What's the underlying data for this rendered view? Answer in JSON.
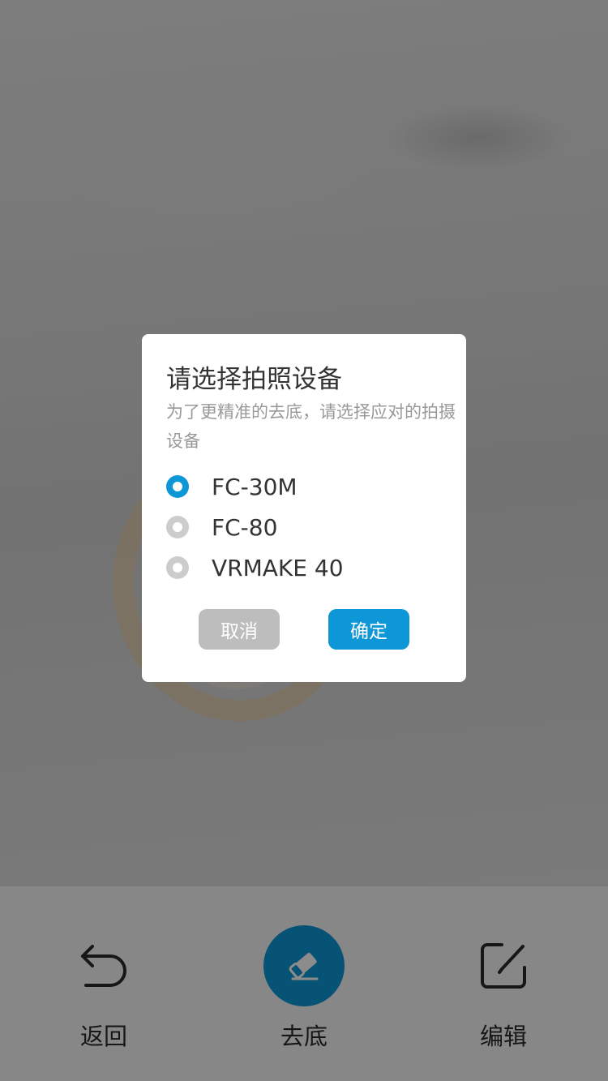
{
  "dialog": {
    "title": "请选择拍照设备",
    "description": "为了更精准的去底，请选择应对的拍摄设备",
    "options": [
      {
        "label": "FC-30M",
        "selected": true
      },
      {
        "label": "FC-80",
        "selected": false
      },
      {
        "label": "VRMAKE 40",
        "selected": false
      }
    ],
    "cancel_label": "取消",
    "confirm_label": "确定"
  },
  "toolbar": {
    "back_label": "返回",
    "back_icon": "undo-arrow-icon",
    "remove_bg_label": "去底",
    "remove_bg_icon": "eraser-icon",
    "edit_label": "编辑",
    "edit_icon": "edit-pencil-icon"
  },
  "colors": {
    "accent": "#0d97d7",
    "cancel_button": "#bdbdbd",
    "radio_unselected": "#cccccc",
    "title_text": "#333333",
    "description_text": "#999999"
  }
}
